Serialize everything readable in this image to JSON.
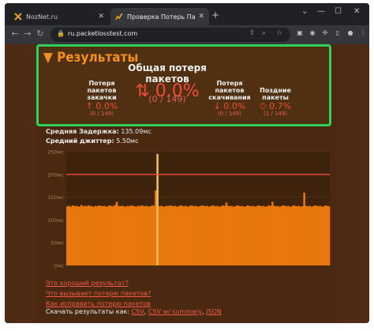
{
  "browser": {
    "tabs": [
      {
        "title": "NozNet.ru",
        "icon": "noznet-favicon"
      },
      {
        "title": "Проверка Потерь Пакетов – Пр",
        "icon": "packetloss-favicon"
      }
    ],
    "url": "ru.packetlosstest.com"
  },
  "results": {
    "heading": "▼ Результаты",
    "total": {
      "label_1": "Общая потеря",
      "label_2": "пакетов",
      "value": "⇅ 0.0%",
      "sub": "(0 / 149)"
    },
    "upload": {
      "label_1": "Потеря",
      "label_2": "пакетов",
      "label_3": "закачки",
      "value": "↑ 0.0%",
      "sub": "(0 / 149)"
    },
    "download": {
      "label_1": "Потеря",
      "label_2": "пакетов",
      "label_3": "скачивания",
      "value": "↓ 0.0%",
      "sub": "(0 / 149)"
    },
    "late": {
      "label_1": "Поздние",
      "label_2": "пакеты",
      "value": "⏱ 0.7%",
      "sub": "(1 / 149)"
    }
  },
  "stats": {
    "latency_label": "Средняя Задержка:",
    "latency_value": "135.09мс",
    "jitter_label": "Средний джиттер:",
    "jitter_value": "5.50мс"
  },
  "chart_data": {
    "type": "bar",
    "ylim": [
      0,
      250
    ],
    "yticks": [
      "250мс",
      "200мс",
      "150мс",
      "100мс",
      "50мс",
      "0мс"
    ],
    "threshold": 200,
    "values": [
      130,
      131,
      129,
      132,
      130,
      131,
      130,
      129,
      133,
      130,
      131,
      130,
      132,
      131,
      130,
      129,
      131,
      130,
      132,
      131,
      130,
      131,
      129,
      130,
      132,
      131,
      130,
      133,
      140,
      131,
      130,
      131,
      130,
      129,
      131,
      130,
      132,
      131,
      130,
      129,
      131,
      130,
      132,
      131,
      130,
      131,
      129,
      130,
      132,
      131,
      165,
      245,
      130,
      131,
      130,
      129,
      131,
      130,
      132,
      131,
      130,
      131,
      129,
      130,
      132,
      131,
      130,
      131,
      129,
      130,
      132,
      131,
      130,
      131,
      129,
      130,
      132,
      131,
      130,
      131,
      129,
      130,
      132,
      131,
      130,
      131,
      129,
      130,
      132,
      131,
      138,
      131,
      130,
      131,
      129,
      130,
      132,
      131,
      130,
      131,
      129,
      130,
      132,
      131,
      130,
      131,
      129,
      130,
      132,
      131,
      130,
      131,
      129,
      130,
      132,
      131,
      140,
      131,
      130,
      131,
      129,
      130,
      132,
      131,
      130,
      131,
      129,
      130,
      132,
      131,
      130,
      131,
      129,
      130,
      160,
      131,
      130,
      131,
      129,
      130,
      132,
      131,
      130,
      131,
      129,
      130,
      132,
      131,
      130
    ],
    "bar_color": "#e8780e",
    "highlight_color": "#e8c85a",
    "threshold_color": "#e5443a"
  },
  "links": [
    "Это хороший результат?",
    "Что вызывает потерю пакетов?",
    "Как исправить потерю пакетов"
  ],
  "download": {
    "label": "Скачать результаты как:",
    "csv": "CSV",
    "csv_summary": "CSV w/ summary",
    "json": "JSON"
  }
}
